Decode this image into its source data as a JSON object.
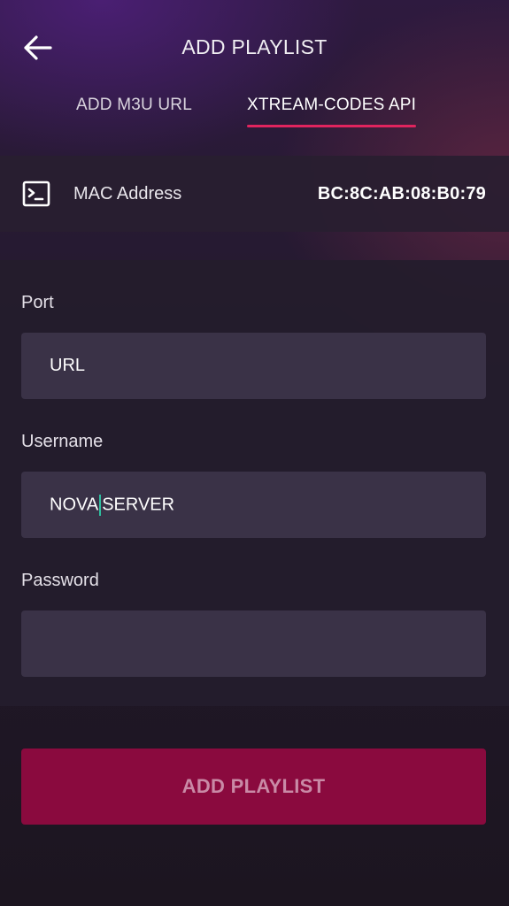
{
  "header": {
    "title": "ADD PLAYLIST",
    "back_icon": "arrow-left-icon"
  },
  "tabs": [
    {
      "label": "ADD M3U URL",
      "active": false
    },
    {
      "label": "XTREAM-CODES API",
      "active": true
    }
  ],
  "mac": {
    "icon": "terminal-icon",
    "label": "MAC Address",
    "value": "BC:8C:AB:08:B0:79"
  },
  "form": {
    "port": {
      "label": "Port",
      "value": "URL"
    },
    "username": {
      "label": "Username",
      "value_before_cursor": "NOVA",
      "value_after_cursor": "SERVER"
    },
    "password": {
      "label": "Password",
      "value": ""
    }
  },
  "submit": {
    "label": "ADD PLAYLIST"
  },
  "colors": {
    "accent": "#e0245e",
    "button": "#8a0a3e",
    "field": "#3a3247",
    "cursor": "#2fbfa0"
  }
}
